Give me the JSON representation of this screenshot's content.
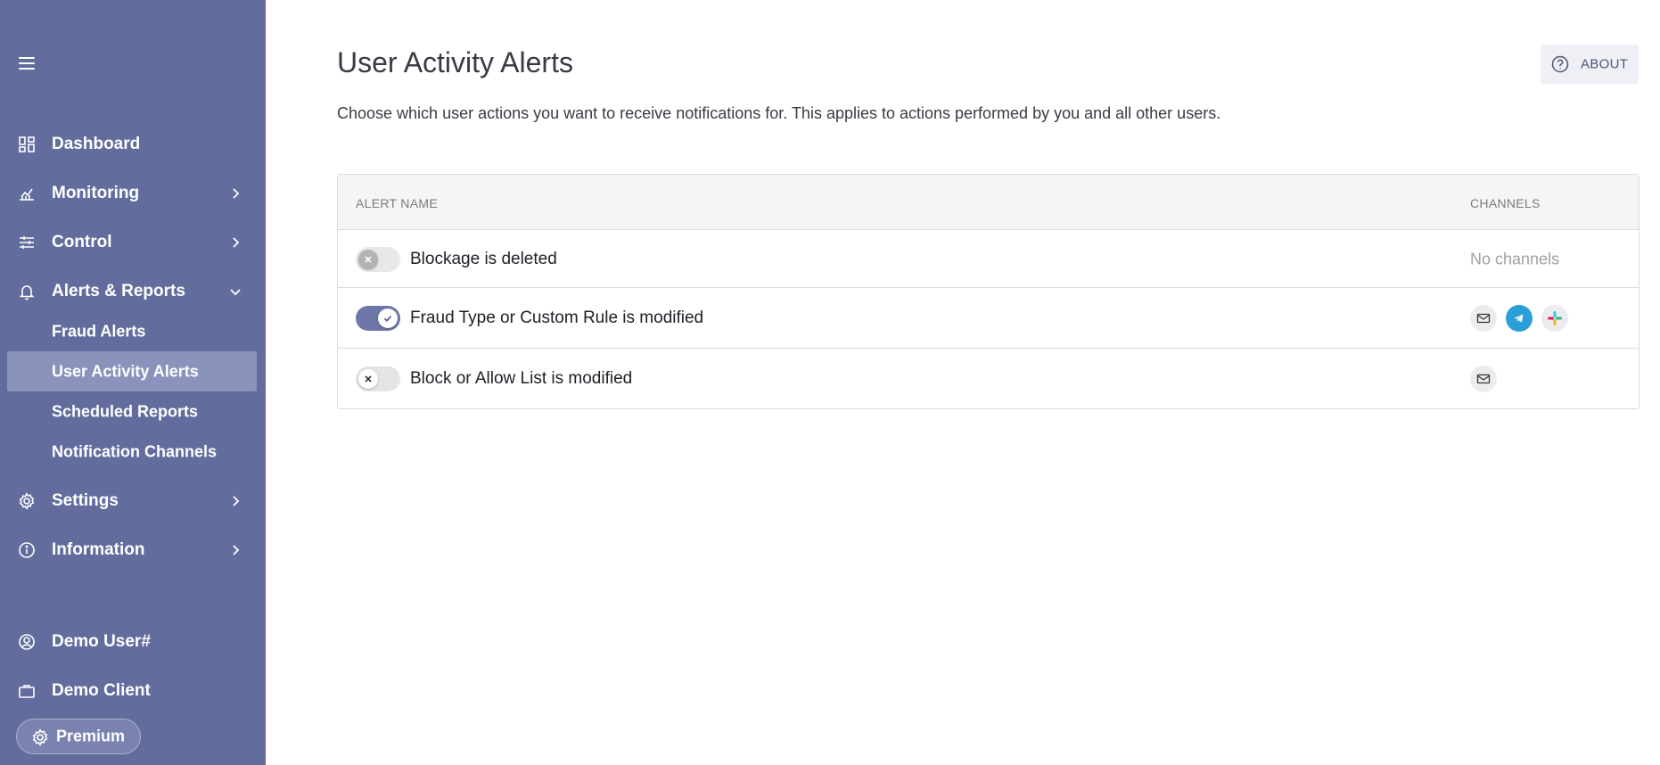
{
  "sidebar": {
    "items": [
      {
        "label": "Dashboard",
        "icon": "dashboard-icon"
      },
      {
        "label": "Monitoring",
        "icon": "chart-icon"
      },
      {
        "label": "Control",
        "icon": "sliders-icon"
      },
      {
        "label": "Alerts & Reports",
        "icon": "bell-icon"
      }
    ],
    "sub_items": [
      {
        "label": "Fraud Alerts"
      },
      {
        "label": "User Activity Alerts"
      },
      {
        "label": "Scheduled Reports"
      },
      {
        "label": "Notification Channels"
      }
    ],
    "items_bottom": [
      {
        "label": "Settings",
        "icon": "gear-icon"
      },
      {
        "label": "Information",
        "icon": "info-icon"
      }
    ],
    "user": {
      "label": "Demo User#"
    },
    "client": {
      "label": "Demo Client"
    },
    "premium": {
      "label": "Premium"
    }
  },
  "page": {
    "title": "User Activity Alerts",
    "subtitle": "Choose which user actions you want to receive notifications for. This applies to actions performed by you and all other users.",
    "about_label": "ABOUT"
  },
  "table": {
    "headers": {
      "name": "ALERT NAME",
      "channels": "CHANNELS"
    },
    "rows": [
      {
        "label": "Blockage is deleted",
        "enabled": false,
        "channels_text": "No channels"
      },
      {
        "label": "Fraud Type or Custom Rule is modified",
        "enabled": true,
        "channels": [
          "email",
          "telegram",
          "slack"
        ]
      },
      {
        "label": "Block or Allow List is modified",
        "enabled": false,
        "channels": [
          "email"
        ]
      }
    ]
  },
  "colors": {
    "sidebar": "#636d9d",
    "active_sub": "#8a93bb",
    "toggle_on": "#6d77a8",
    "telegram": "#2a9fd8"
  }
}
